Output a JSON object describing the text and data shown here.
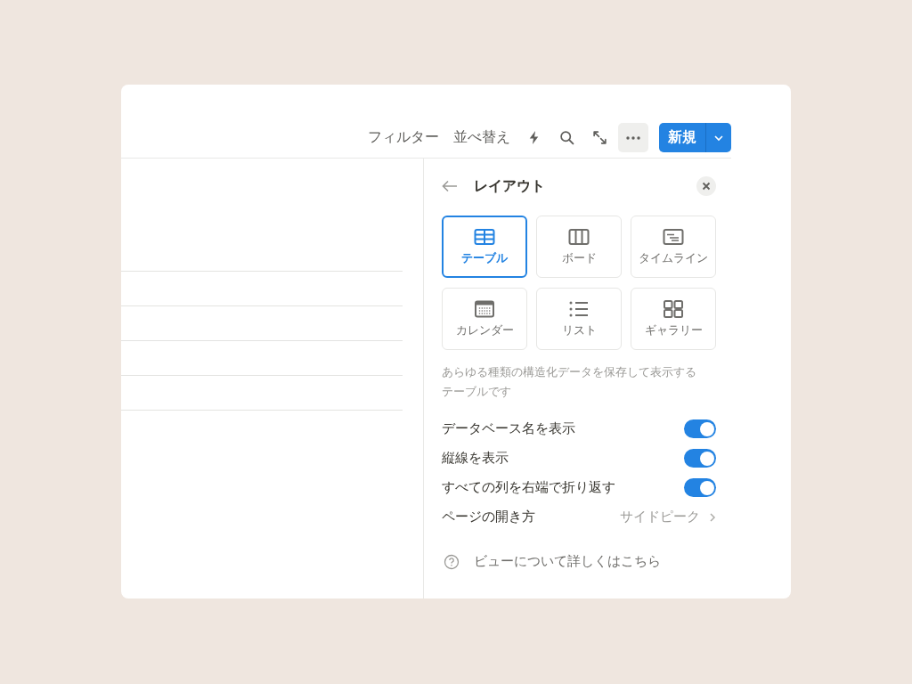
{
  "toolbar": {
    "filter": "フィルター",
    "sort": "並べ替え",
    "new_button": "新規"
  },
  "layout_panel": {
    "title": "レイアウト",
    "layouts": [
      {
        "kind": "table",
        "label": "テーブル",
        "selected": true
      },
      {
        "kind": "board",
        "label": "ボード",
        "selected": false
      },
      {
        "kind": "timeline",
        "label": "タイムライン",
        "selected": false
      },
      {
        "kind": "calendar",
        "label": "カレンダー",
        "selected": false
      },
      {
        "kind": "list",
        "label": "リスト",
        "selected": false
      },
      {
        "kind": "gallery",
        "label": "ギャラリー",
        "selected": false
      }
    ],
    "description": "あらゆる種類の構造化データを保存して表示するテーブルです",
    "settings": [
      {
        "kind": "toggle",
        "label": "データベース名を表示",
        "on": true
      },
      {
        "kind": "toggle",
        "label": "縦線を表示",
        "on": true
      },
      {
        "kind": "toggle",
        "label": "すべての列を右端で折り返す",
        "on": true
      },
      {
        "kind": "link",
        "label": "ページの開き方",
        "value": "サイドピーク"
      }
    ],
    "help_link": "ビューについて詳しくはこちら"
  }
}
